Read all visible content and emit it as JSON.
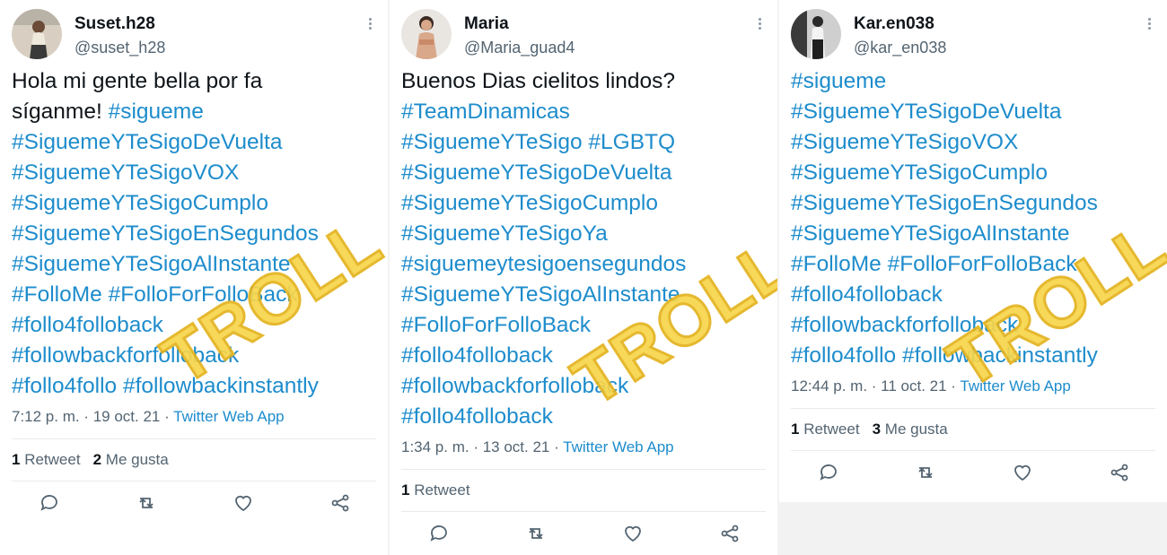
{
  "colors": {
    "hashtag": "#1d8ccc",
    "text": "#0f1419",
    "muted": "#536471",
    "troll": "#f7d54a"
  },
  "stamp": "TROLL",
  "tweets": [
    {
      "name": "Suset.h28",
      "handle": "@suset_h28",
      "lines": [
        [
          {
            "t": "Hola mi gente bella por fa",
            "k": "plain"
          }
        ],
        [
          {
            "t": "síganme! ",
            "k": "plain"
          },
          {
            "t": "#sigueme",
            "k": "tag"
          }
        ],
        [
          {
            "t": "#SiguemeYTeSigoDeVuelta",
            "k": "tag"
          }
        ],
        [
          {
            "t": "#SiguemeYTeSigoVOX",
            "k": "tag"
          }
        ],
        [
          {
            "t": "#SiguemeYTeSigoCumplo",
            "k": "tag"
          }
        ],
        [
          {
            "t": "#SiguemeYTeSigoEnSegundos",
            "k": "tag"
          }
        ],
        [
          {
            "t": "#SiguemeYTeSigoAlInstante",
            "k": "tag"
          }
        ],
        [
          {
            "t": "#FolloMe #FolloForFolloBack",
            "k": "tag"
          }
        ],
        [
          {
            "t": "#follo4folloback",
            "k": "tag"
          }
        ],
        [
          {
            "t": "#followbackforfolloback",
            "k": "tag"
          }
        ],
        [
          {
            "t": "#follo4follo  #followbackinstantly",
            "k": "tag"
          }
        ]
      ],
      "time": "7:12 p. m. · 19 oct. 21 · ",
      "source": "Twitter Web App",
      "retweets": "1",
      "retweets_label": "Retweet",
      "likes": "2",
      "likes_label": "Me gusta"
    },
    {
      "name": "Maria",
      "handle": "@Maria_guad4",
      "lines": [
        [
          {
            "t": "Buenos Dias cielitos lindos?",
            "k": "plain"
          }
        ],
        [
          {
            "t": "#TeamDinamicas",
            "k": "tag"
          }
        ],
        [
          {
            "t": "#SiguemeYTeSigo #LGBTQ",
            "k": "tag"
          }
        ],
        [
          {
            "t": "#SiguemeYTeSigoDeVuelta",
            "k": "tag"
          }
        ],
        [
          {
            "t": "#SiguemeYTeSigoCumplo",
            "k": "tag"
          }
        ],
        [
          {
            "t": "#SiguemeYTeSigoYa",
            "k": "tag"
          }
        ],
        [
          {
            "t": "#siguemeytesigoensegundos",
            "k": "tag"
          }
        ],
        [
          {
            "t": "#SiguemeYTeSigoAlInstante",
            "k": "tag"
          }
        ],
        [
          {
            "t": "#FolloForFolloBack",
            "k": "tag"
          }
        ],
        [
          {
            "t": "#follo4folloback",
            "k": "tag"
          }
        ],
        [
          {
            "t": "#followbackforfolloback",
            "k": "tag"
          }
        ],
        [
          {
            "t": "#follo4folloback",
            "k": "tag"
          }
        ]
      ],
      "time": "1:34 p. m. · 13 oct. 21 · ",
      "source": "Twitter Web App",
      "retweets": "1",
      "retweets_label": "Retweet"
    },
    {
      "name": "Kar.en038",
      "handle": "@kar_en038",
      "lines": [
        [
          {
            "t": "#sigueme",
            "k": "tag"
          }
        ],
        [
          {
            "t": "#SiguemeYTeSigoDeVuelta",
            "k": "tag"
          }
        ],
        [
          {
            "t": "#SiguemeYTeSigoVOX",
            "k": "tag"
          }
        ],
        [
          {
            "t": "#SiguemeYTeSigoCumplo",
            "k": "tag"
          }
        ],
        [
          {
            "t": "#SiguemeYTeSigoEnSegundos",
            "k": "tag"
          }
        ],
        [
          {
            "t": "#SiguemeYTeSigoAlInstante",
            "k": "tag"
          }
        ],
        [
          {
            "t": "#FolloMe #FolloForFolloBack",
            "k": "tag"
          }
        ],
        [
          {
            "t": "#follo4folloback",
            "k": "tag"
          }
        ],
        [
          {
            "t": "#followbackforfolloback",
            "k": "tag"
          }
        ],
        [
          {
            "t": "#follo4follo  #followbackinstantly",
            "k": "tag"
          }
        ]
      ],
      "time": "12:44 p. m. · 11 oct. 21 · ",
      "source": "Twitter Web App",
      "retweets": "1",
      "retweets_label": "Retweet",
      "likes": "3",
      "likes_label": "Me gusta"
    }
  ]
}
